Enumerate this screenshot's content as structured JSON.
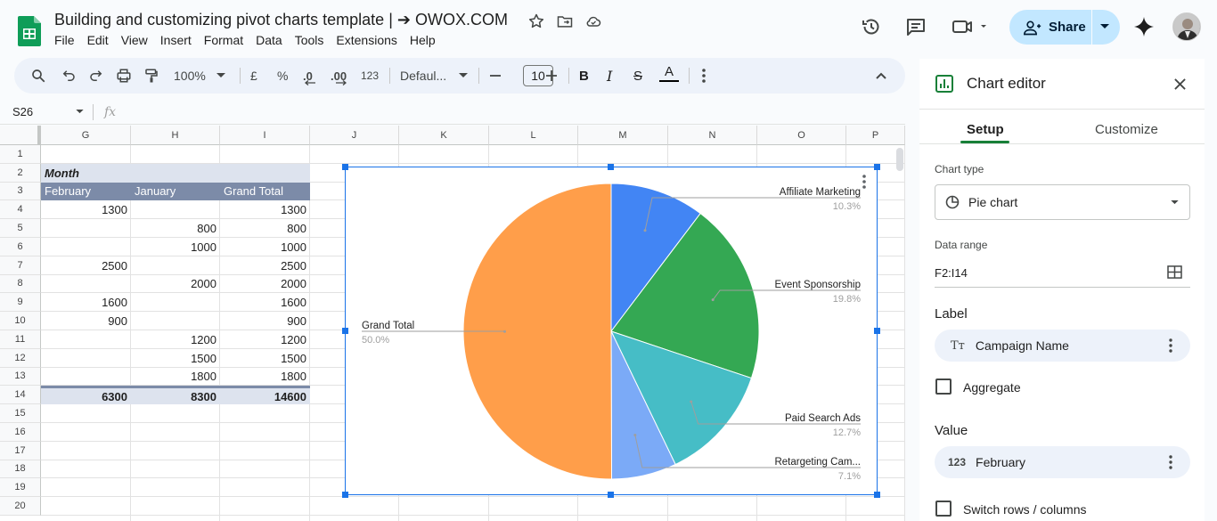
{
  "doc": {
    "title": "Building and customizing pivot charts template | ➔ OWOX.COM",
    "menu": [
      "File",
      "Edit",
      "View",
      "Insert",
      "Format",
      "Data",
      "Tools",
      "Extensions",
      "Help"
    ],
    "share_label": "Share"
  },
  "toolbar": {
    "zoom": "100%",
    "currency": "£",
    "percent": "%",
    "dec_decrease": ".0",
    "dec_increase": ".00",
    "number_format": "123",
    "font": "Defaul...",
    "font_size": "10",
    "bold": "B",
    "italic": "I",
    "strike": "S",
    "text_color": "A"
  },
  "formula": {
    "name_box": "S26",
    "fx": "fx"
  },
  "columns": [
    "G",
    "H",
    "I",
    "J",
    "K",
    "L",
    "M",
    "N",
    "O",
    "P"
  ],
  "rows": [
    "1",
    "2",
    "3",
    "4",
    "5",
    "6",
    "7",
    "8",
    "9",
    "10",
    "11",
    "12",
    "13",
    "14",
    "15",
    "16",
    "17",
    "18",
    "19",
    "20"
  ],
  "pivot": {
    "row_label": "Month",
    "headers": [
      "February",
      "January",
      "Grand Total"
    ],
    "data": [
      [
        "1300",
        "",
        "1300"
      ],
      [
        "",
        "800",
        "800"
      ],
      [
        "",
        "1000",
        "1000"
      ],
      [
        "2500",
        "",
        "2500"
      ],
      [
        "",
        "2000",
        "2000"
      ],
      [
        "1600",
        "",
        "1600"
      ],
      [
        "900",
        "",
        "900"
      ],
      [
        "",
        "1200",
        "1200"
      ],
      [
        "",
        "1500",
        "1500"
      ],
      [
        "",
        "1800",
        "1800"
      ]
    ],
    "totals": [
      "6300",
      "8300",
      "14600"
    ]
  },
  "chart_data": {
    "type": "pie",
    "categories": [
      "Affiliate Marketing",
      "Event Sponsorship",
      "Paid Search Ads",
      "Retargeting Cam...",
      "Grand Total"
    ],
    "values": [
      10.3,
      19.8,
      12.7,
      7.1,
      50.0
    ],
    "percent_labels": [
      "10.3%",
      "19.8%",
      "12.7%",
      "7.1%",
      "50.0%"
    ],
    "colors": [
      "#4285f4",
      "#34a853",
      "#46bdc6",
      "#7baaf7",
      "#ff9e4a"
    ],
    "legend": "labeled slices"
  },
  "sidebar": {
    "title": "Chart editor",
    "tabs": [
      "Setup",
      "Customize"
    ],
    "chart_type_label": "Chart type",
    "chart_type": "Pie chart",
    "data_range_label": "Data range",
    "data_range": "F2:I14",
    "label_section": "Label",
    "label_value": "Campaign Name",
    "aggregate": "Aggregate",
    "value_section": "Value",
    "value_value": "February",
    "switch": "Switch rows / columns",
    "accent": "#188038"
  }
}
